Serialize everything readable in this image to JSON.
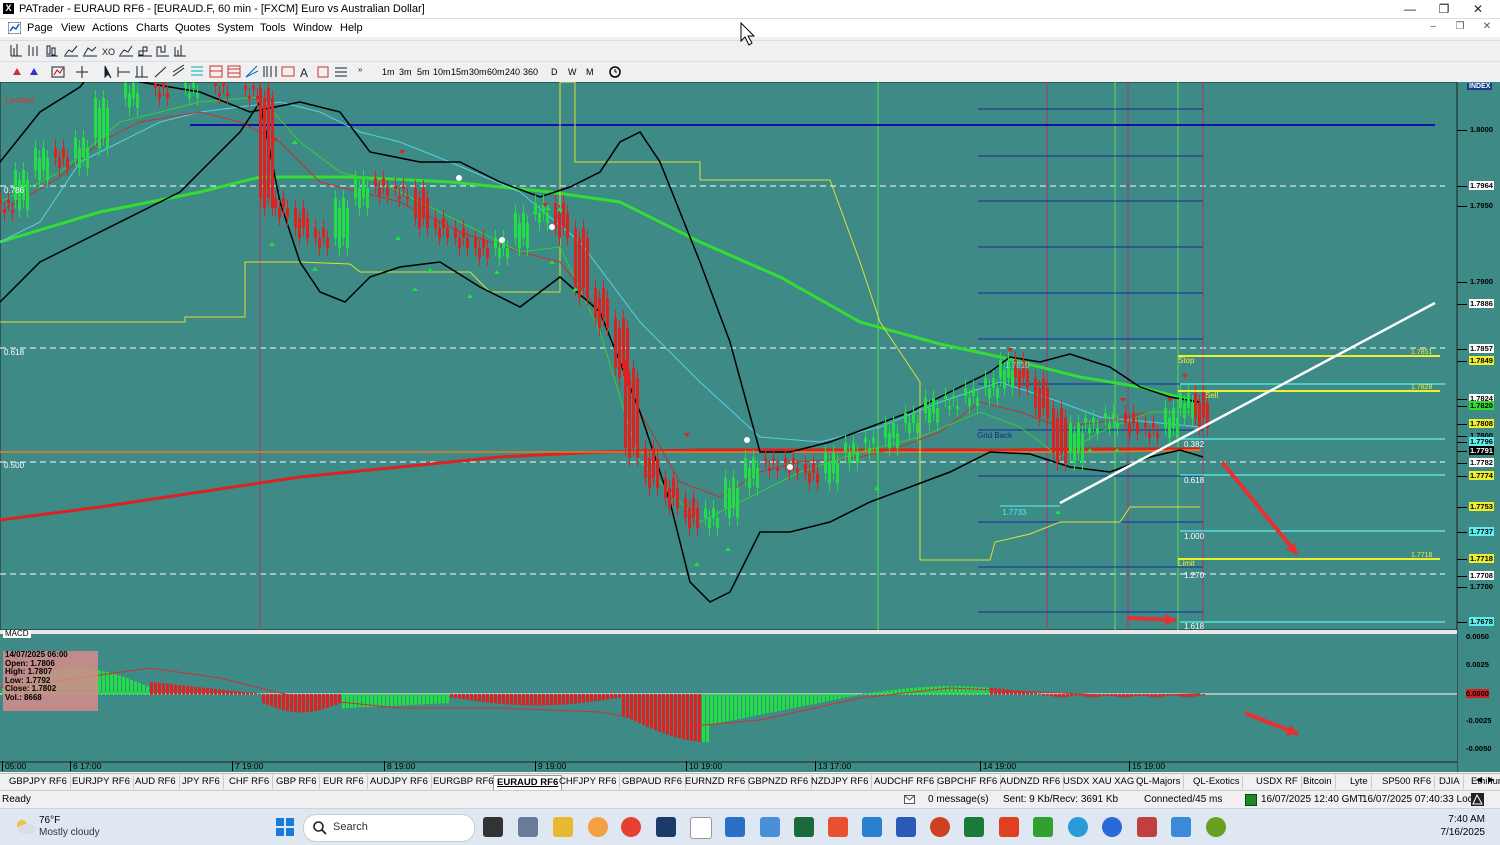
{
  "window": {
    "title": "PATrader - EURAUD RF6 - [EURAUD.F, 60 min - [FXCM] Euro vs Australian Dollar]",
    "app_icon_letter": "X",
    "minimize": "—",
    "maximize": "❐",
    "close": "✕"
  },
  "menu": {
    "items": [
      "Page",
      "View",
      "Actions",
      "Charts",
      "Quotes",
      "System",
      "Tools",
      "Window",
      "Help"
    ],
    "mdi_buttons": [
      "–",
      "❐",
      "✕"
    ]
  },
  "toolbar": {
    "timeframes": [
      "1m",
      "3m",
      "5m",
      "10m",
      "15m",
      "30m",
      "60m",
      "240",
      "360",
      "D",
      "W",
      "M"
    ]
  },
  "chart": {
    "symbol": "EURAUD.F",
    "locked_label": "Locked",
    "index_label": "INDEX",
    "fib_left_labels": [
      "0.786",
      "0.618",
      "0.500"
    ],
    "price_axis": [
      "1.8000",
      "1.7964",
      "1.7950",
      "1.7900",
      "1.7886",
      "1.7857",
      "1.7849",
      "1.7824",
      "1.7820",
      "1.7808",
      "1.7800",
      "1.7796",
      "1.7791",
      "1.7782",
      "1.7774",
      "1.7753",
      "1.7737",
      "1.7718",
      "1.7708",
      "1.7700",
      "1.7678"
    ],
    "line_labels": {
      "stop": "Stop",
      "limit": "Limit",
      "sell": "Sell",
      "grid_back": "Grid Back",
      "low_mark": "1.7733",
      "high_mark": "1.7810",
      "level_1": "1.7851",
      "level_2": "1.7828",
      "level_3": "1.7718"
    },
    "fib_right_labels": [
      "0.382",
      "0.618",
      "1.000",
      "1.270",
      "1.618"
    ],
    "time_axis": [
      "05:00",
      "6 17:00",
      "7 19:00",
      "8 19:00",
      "9 19:00",
      "10 19:00",
      "13 17:00",
      "14 19:00",
      "15 19:00"
    ],
    "macd_label": "MACD",
    "macd_axis": [
      "0.0050",
      "0.0025",
      "0.0000",
      "-0.0025",
      "-0.0050"
    ],
    "ohlc": {
      "date": "14/07/2025 06:00",
      "open": "Open: 1.7806",
      "high": "High: 1.7807",
      "low": "Low: 1.7792",
      "close": "Close: 1.7802",
      "vol": "Vol.: 8668"
    }
  },
  "tabs": [
    "GBPJPY RF6",
    "EURJPY RF6",
    "AUD RF6",
    "JPY RF6",
    "CHF RF6",
    "GBP RF6",
    "EUR RF6",
    "AUDJPY RF6",
    "EURGBP RF6",
    "EURAUD RF6",
    "CHFJPY RF6",
    "GBPAUD RF6",
    "EURNZD RF6",
    "GBPNZD RF6",
    "NZDJPY RF6",
    "AUDCHF RF6",
    "GBPCHF RF6",
    "AUDNZD RF6",
    "USDX XAU XAG",
    "QL-Majors",
    "QL-Exotics",
    "USDX RF",
    "Bitcoin",
    "Lyte",
    "SP500 RF6",
    "DJIA",
    "Ethirium"
  ],
  "active_tab": "EURAUD RF6",
  "status": {
    "ready": "Ready",
    "messages": "0 message(s)",
    "sent": "Sent: 9 Kb/Recv: 3691 Kb",
    "connected": "Connected/45 ms",
    "gmt": "16/07/2025 12:40 GMT",
    "local": "16/07/2025 07:40:33 Local"
  },
  "taskbar": {
    "weather_temp": "76°F",
    "weather_desc": "Mostly cloudy",
    "search_placeholder": "Search",
    "time": "7:40 AM",
    "date": "7/16/2025"
  },
  "colors": {
    "chart_bg": "#3d8a86",
    "bull": "#22dd44",
    "bear": "#dd2222",
    "ma_green": "#33dd33",
    "ma_red": "#dd2222",
    "bands": "#000000",
    "envelope": "#e0e030",
    "resistance": "#1010aa"
  }
}
